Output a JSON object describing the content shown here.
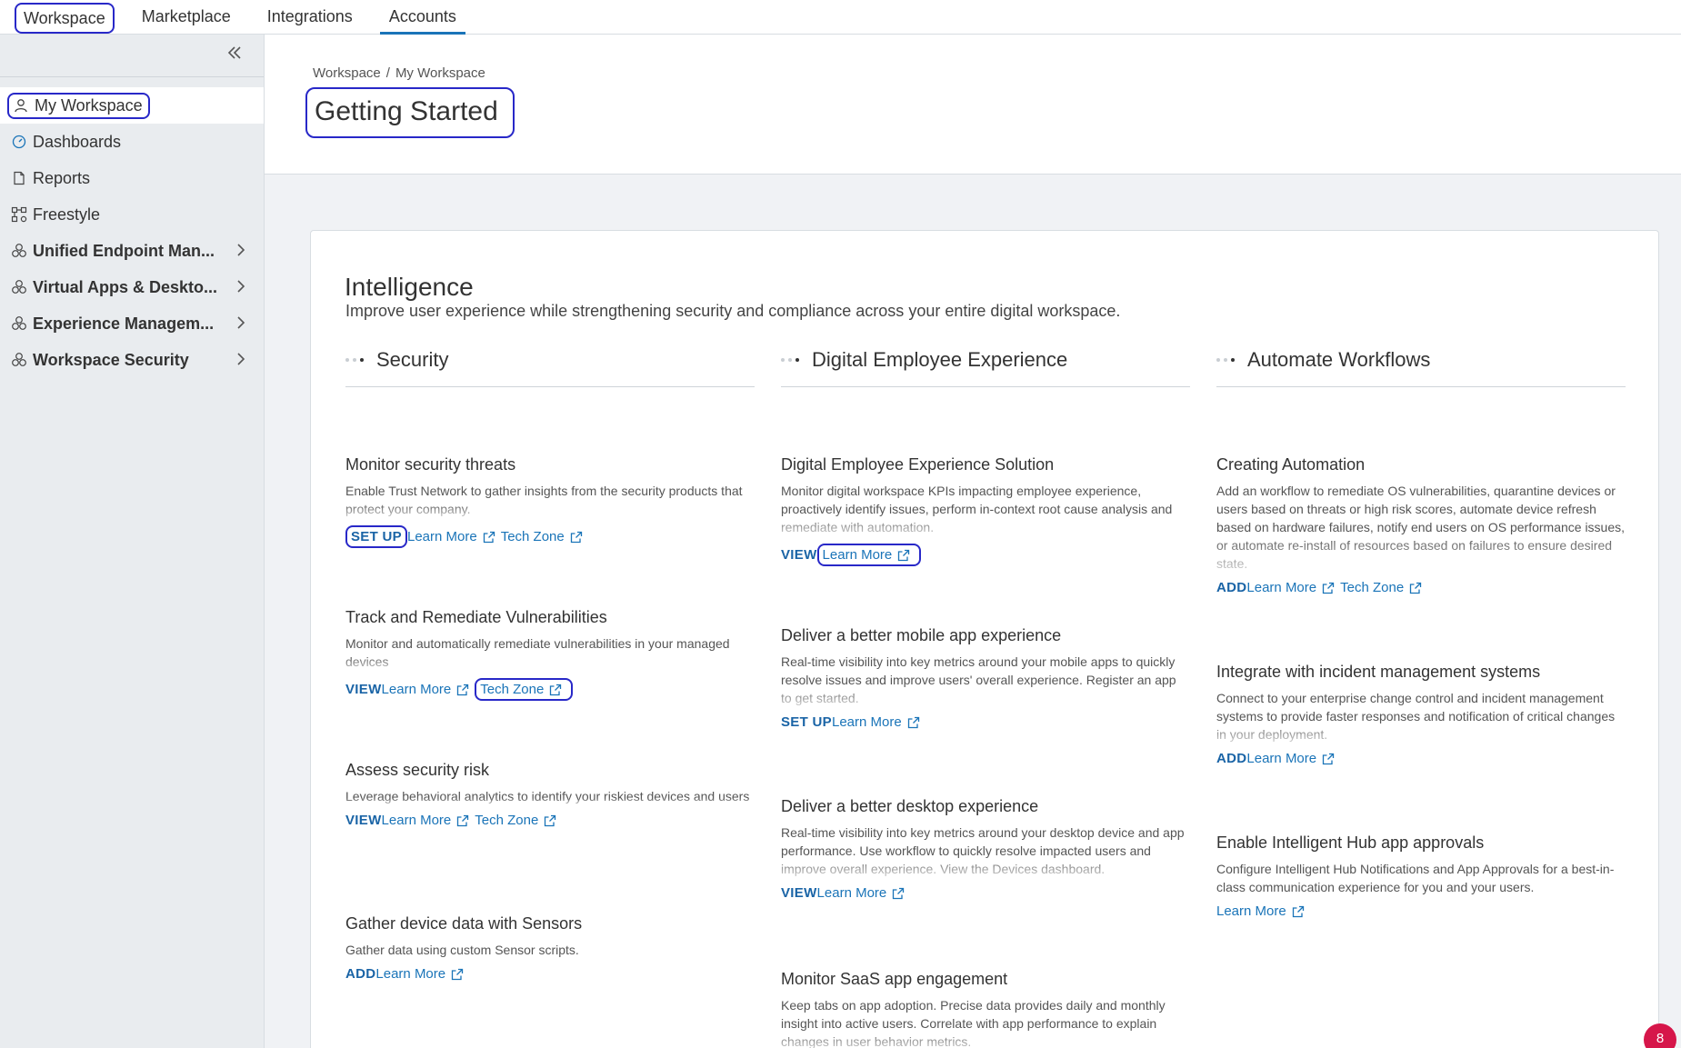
{
  "topnav": {
    "tabs": [
      {
        "label": "Workspace"
      },
      {
        "label": "Marketplace"
      },
      {
        "label": "Integrations"
      },
      {
        "label": "Accounts"
      }
    ]
  },
  "sidebar": {
    "collapse_icon": "double-chevron-left-icon",
    "items": [
      {
        "label": "My Workspace",
        "icon": "user-icon"
      },
      {
        "label": "Dashboards",
        "icon": "gauge-icon"
      },
      {
        "label": "Reports",
        "icon": "document-icon"
      },
      {
        "label": "Freestyle",
        "icon": "workflow-icon"
      },
      {
        "label": "Unified Endpoint Man...",
        "icon": "cluster-icon"
      },
      {
        "label": "Virtual Apps & Deskto...",
        "icon": "cluster-icon"
      },
      {
        "label": "Experience Managem...",
        "icon": "cluster-icon"
      },
      {
        "label": "Workspace Security",
        "icon": "cluster-icon"
      }
    ]
  },
  "header": {
    "breadcrumb": [
      "Workspace",
      "/",
      "My Workspace"
    ],
    "title": "Getting Started"
  },
  "card": {
    "title": "Intelligence",
    "subtitle": "Improve user experience while strengthening security and compliance across your entire digital workspace.",
    "columns": [
      {
        "heading": "Security",
        "items": [
          {
            "title": "Monitor security threats",
            "desc": "Enable Trust Network to gather insights from the security products that protect your company.",
            "primary": "SET UP",
            "learn": "Learn More",
            "tech": "Tech Zone"
          },
          {
            "title": "Track and Remediate Vulnerabilities",
            "desc": "Monitor and automatically remediate vulnerabilities in your managed devices",
            "primary": "VIEW",
            "learn": "Learn More",
            "tech": "Tech Zone"
          },
          {
            "title": "Assess security risk",
            "desc": "Leverage behavioral analytics to identify your riskiest devices and users",
            "primary": "VIEW",
            "learn": "Learn More",
            "tech": "Tech Zone"
          },
          {
            "title": "Gather device data with Sensors",
            "desc": "Gather data using custom Sensor scripts.",
            "primary": "ADD",
            "learn": "Learn More"
          }
        ]
      },
      {
        "heading": "Digital Employee Experience",
        "items": [
          {
            "title": "Digital Employee Experience Solution",
            "desc": "Monitor digital workspace KPIs impacting employee experience, proactively identify issues, perform in-context root cause analysis and remediate with automation.",
            "primary": "VIEW",
            "learn": "Learn More"
          },
          {
            "title": "Deliver a better mobile app experience",
            "desc": "Real-time visibility into key metrics around your mobile apps to quickly resolve issues and improve users' overall experience. Register an app to get started.",
            "primary": "SET UP",
            "learn": "Learn More"
          },
          {
            "title": "Deliver a better desktop experience",
            "desc": "Real-time visibility into key metrics around your desktop device and app performance. Use workflow to quickly resolve impacted users and improve overall experience. View the Devices dashboard.",
            "primary": "VIEW",
            "learn": "Learn More"
          },
          {
            "title": "Monitor SaaS app engagement",
            "desc": "Keep tabs on app adoption. Precise data provides daily and monthly insight into active users. Correlate with app performance to explain changes in user behavior metrics."
          }
        ]
      },
      {
        "heading": "Automate Workflows",
        "items": [
          {
            "title": "Creating Automation",
            "desc": "Add an workflow to remediate OS vulnerabilities, quarantine devices or users based on threats or high risk scores, automate device refresh based on hardware failures, notify end users on OS performance issues, or automate re-install of resources based on failures to ensure desired state.",
            "primary": "ADD",
            "learn": "Learn More",
            "tech": "Tech Zone"
          },
          {
            "title": "Integrate with incident management systems",
            "desc": "Connect to your enterprise change control and incident management systems to provide faster responses and notification of critical changes in your deployment.",
            "primary": "ADD",
            "learn": "Learn More"
          },
          {
            "title": "Enable Intelligent Hub app approvals",
            "desc": "Configure Intelligent Hub Notifications and App Approvals for a best-in-class communication experience for you and your users.",
            "learn": "Learn More"
          }
        ]
      }
    ]
  },
  "notification_badge": {
    "count": "8"
  },
  "colors": {
    "accent": "#1a74b8",
    "highlight": "#2828c8",
    "badge": "#d6164a"
  }
}
